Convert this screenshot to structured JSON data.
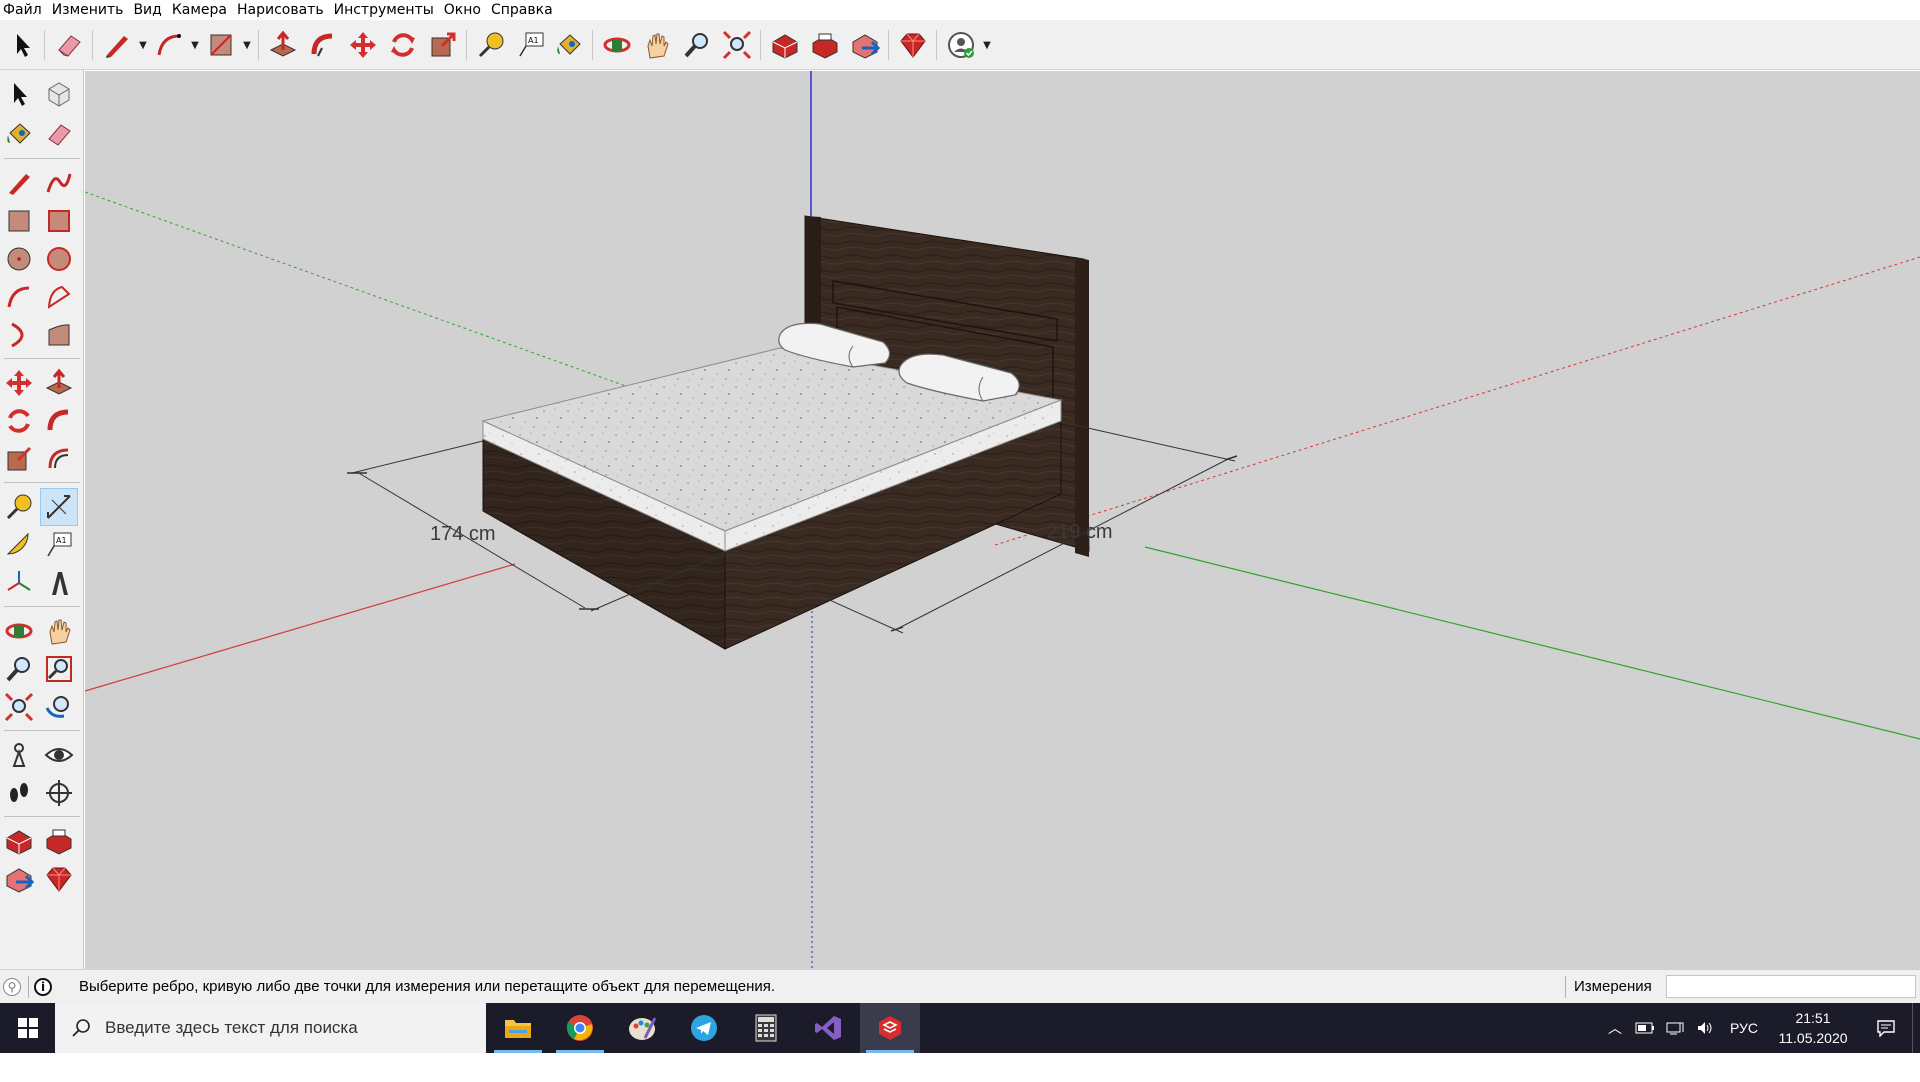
{
  "menu": {
    "items": [
      "Файл",
      "Изменить",
      "Вид",
      "Камера",
      "Нарисовать",
      "Инструменты",
      "Окно",
      "Справка"
    ]
  },
  "toolbar": {
    "tools": [
      "select-arrow-icon",
      "eraser-icon",
      "pencil-line-icon",
      "arc-icon",
      "rectangle-icon",
      "push-pull-icon",
      "follow-me-icon",
      "move-icon",
      "rotate-icon",
      "scale-icon",
      "tape-measure-icon",
      "text-label-icon",
      "paint-bucket-icon",
      "orbit-icon",
      "pan-hand-icon",
      "zoom-icon",
      "zoom-extents-icon",
      "warehouse-icon",
      "extension-warehouse-icon",
      "share-model-icon",
      "ruby-gem-icon",
      "account-icon"
    ]
  },
  "viewport": {
    "dimension_width": "174 cm",
    "dimension_length": "219 cm",
    "colors": {
      "background": "#d1d1d1",
      "red_axis": "#cc2020",
      "green_axis": "#20a020",
      "blue_axis": "#2020cc",
      "wood": "#3a2b22",
      "mattress": "#dcdcdc"
    }
  },
  "status": {
    "message": "Выберите ребро, кривую либо две точки для измерения или перетащите объект для перемещения.",
    "vcb_label": "Измерения",
    "vcb_value": ""
  },
  "taskbar": {
    "search_placeholder": "Введите здесь текст для поиска",
    "apps": [
      "file-explorer-icon",
      "chrome-icon",
      "paint-icon",
      "telegram-icon",
      "calculator-icon",
      "visual-studio-icon",
      "sketchup-icon"
    ],
    "lang": "РУС",
    "time": "21:51",
    "date": "11.05.2020"
  }
}
